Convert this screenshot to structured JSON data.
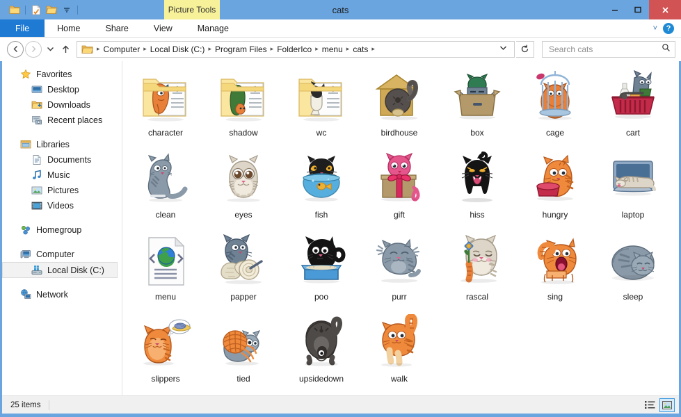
{
  "window": {
    "title": "cats",
    "contextual_tab_group": "Picture Tools",
    "minimize_glyph": "—",
    "maximize_glyph": "❐",
    "close_glyph": "✕"
  },
  "quick_access": {
    "items": [
      {
        "name": "folder-icon",
        "label": "Properties"
      },
      {
        "name": "new-folder-icon",
        "label": "New folder"
      },
      {
        "name": "folder-open-icon",
        "label": "Open"
      },
      {
        "name": "chevron-down-icon",
        "label": "Customize Quick Access Toolbar"
      }
    ]
  },
  "ribbon": {
    "tabs": [
      {
        "label": "File",
        "selected": true
      },
      {
        "label": "Home",
        "selected": false
      },
      {
        "label": "Share",
        "selected": false
      },
      {
        "label": "View",
        "selected": false
      },
      {
        "label": "Manage",
        "selected": false
      }
    ],
    "expand_glyph": "˅",
    "help_glyph": "?"
  },
  "address": {
    "back_glyph": "←",
    "forward_glyph": "→",
    "recent_glyph": "˅",
    "up_glyph": "↑",
    "breadcrumbs": [
      "Computer",
      "Local Disk (C:)",
      "Program Files",
      "FolderIco",
      "menu",
      "cats"
    ],
    "separator": "▸",
    "dropdown_glyph": "˅",
    "refresh_glyph": "↻"
  },
  "search": {
    "placeholder": "Search cats",
    "value": "",
    "icon": "search-icon"
  },
  "sidebar": {
    "groups": [
      {
        "header": {
          "label": "Favorites",
          "icon": "star-icon"
        },
        "items": [
          {
            "label": "Desktop",
            "icon": "desktop-icon"
          },
          {
            "label": "Downloads",
            "icon": "downloads-icon"
          },
          {
            "label": "Recent places",
            "icon": "recent-places-icon"
          }
        ]
      },
      {
        "header": {
          "label": "Libraries",
          "icon": "libraries-icon"
        },
        "items": [
          {
            "label": "Documents",
            "icon": "documents-icon"
          },
          {
            "label": "Music",
            "icon": "music-icon"
          },
          {
            "label": "Pictures",
            "icon": "pictures-icon"
          },
          {
            "label": "Videos",
            "icon": "videos-icon"
          }
        ]
      },
      {
        "header": {
          "label": "Homegroup",
          "icon": "homegroup-icon"
        },
        "items": []
      },
      {
        "header": {
          "label": "Computer",
          "icon": "computer-icon"
        },
        "items": [
          {
            "label": "Local Disk (C:)",
            "icon": "local-disk-icon",
            "selected": true
          }
        ]
      },
      {
        "header": {
          "label": "Network",
          "icon": "network-icon"
        },
        "items": []
      }
    ]
  },
  "files": [
    {
      "label": "character",
      "icon": "folder-cat-character"
    },
    {
      "label": "shadow",
      "icon": "folder-cat-shadow"
    },
    {
      "label": "wc",
      "icon": "folder-cat-wc"
    },
    {
      "label": "birdhouse",
      "icon": "cat-birdhouse"
    },
    {
      "label": "box",
      "icon": "cat-box"
    },
    {
      "label": "cage",
      "icon": "cat-cage"
    },
    {
      "label": "cart",
      "icon": "cat-cart"
    },
    {
      "label": "clean",
      "icon": "cat-clean"
    },
    {
      "label": "eyes",
      "icon": "cat-eyes"
    },
    {
      "label": "fish",
      "icon": "cat-fish"
    },
    {
      "label": "gift",
      "icon": "cat-gift"
    },
    {
      "label": "hiss",
      "icon": "cat-hiss"
    },
    {
      "label": "hungry",
      "icon": "cat-hungry"
    },
    {
      "label": "laptop",
      "icon": "cat-laptop"
    },
    {
      "label": "menu",
      "icon": "html-document"
    },
    {
      "label": "papper",
      "icon": "cat-papper"
    },
    {
      "label": "poo",
      "icon": "cat-poo"
    },
    {
      "label": "purr",
      "icon": "cat-purr"
    },
    {
      "label": "rascal",
      "icon": "cat-rascal"
    },
    {
      "label": "sing",
      "icon": "cat-sing"
    },
    {
      "label": "sleep",
      "icon": "cat-sleep"
    },
    {
      "label": "slippers",
      "icon": "cat-slippers"
    },
    {
      "label": "tied",
      "icon": "cat-tied"
    },
    {
      "label": "upsidedown",
      "icon": "cat-upsidedown"
    },
    {
      "label": "walk",
      "icon": "cat-walk"
    }
  ],
  "statusbar": {
    "item_count": "25 items",
    "views": [
      {
        "name": "details-view-button",
        "active": false
      },
      {
        "name": "large-icons-view-button",
        "active": true
      }
    ]
  },
  "colors": {
    "titlebar": "#6aa5e0",
    "file_tab": "#1f7ad4",
    "contextual_tab": "#f7f29a",
    "close_button": "#d25353",
    "selection": "#f2f2f2",
    "status_bg": "#f0f0f0"
  }
}
